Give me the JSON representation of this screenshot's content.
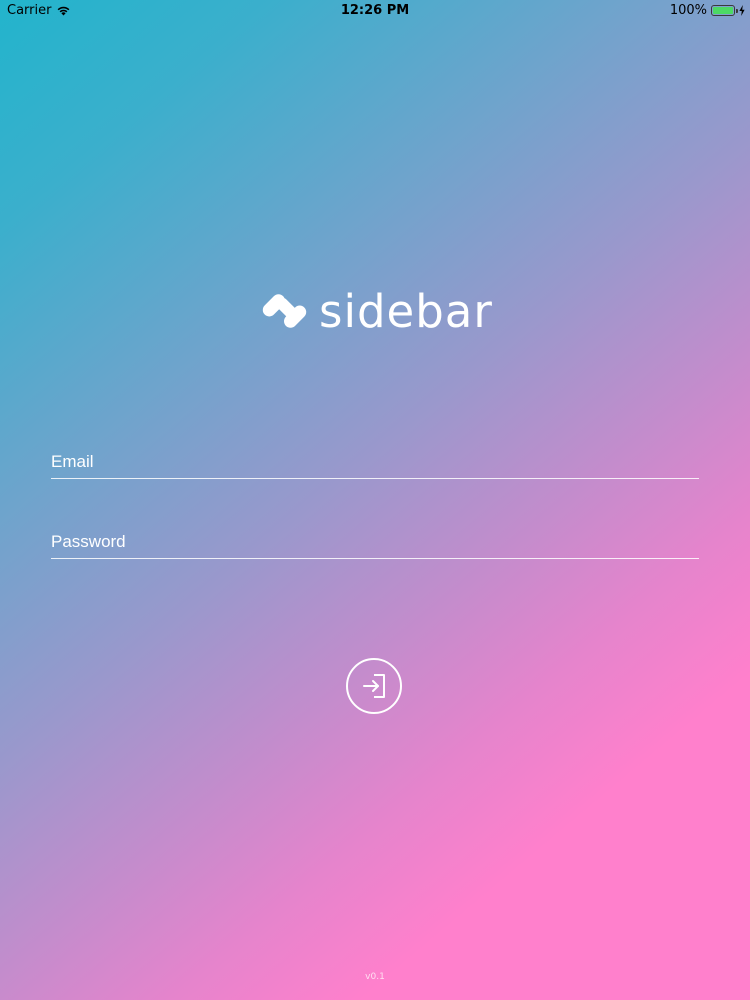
{
  "status_bar": {
    "carrier": "Carrier",
    "wifi_icon": "wifi-icon",
    "time": "12:26 PM",
    "battery_percent": "100%",
    "battery_level": 1.0,
    "battery_icon": "battery-icon",
    "charging_icon": "charging-bolt-icon"
  },
  "logo": {
    "icon": "sidebar-logo-icon",
    "text": "sidebar"
  },
  "form": {
    "email": {
      "placeholder": "Email",
      "value": ""
    },
    "password": {
      "placeholder": "Password",
      "value": ""
    },
    "login_icon": "sign-in-icon"
  },
  "version": "v0.1",
  "colors": {
    "gradient_start": "#22b4cc",
    "gradient_end": "#ff80cc",
    "text": "#ffffff",
    "battery_fill": "#4cd964"
  }
}
